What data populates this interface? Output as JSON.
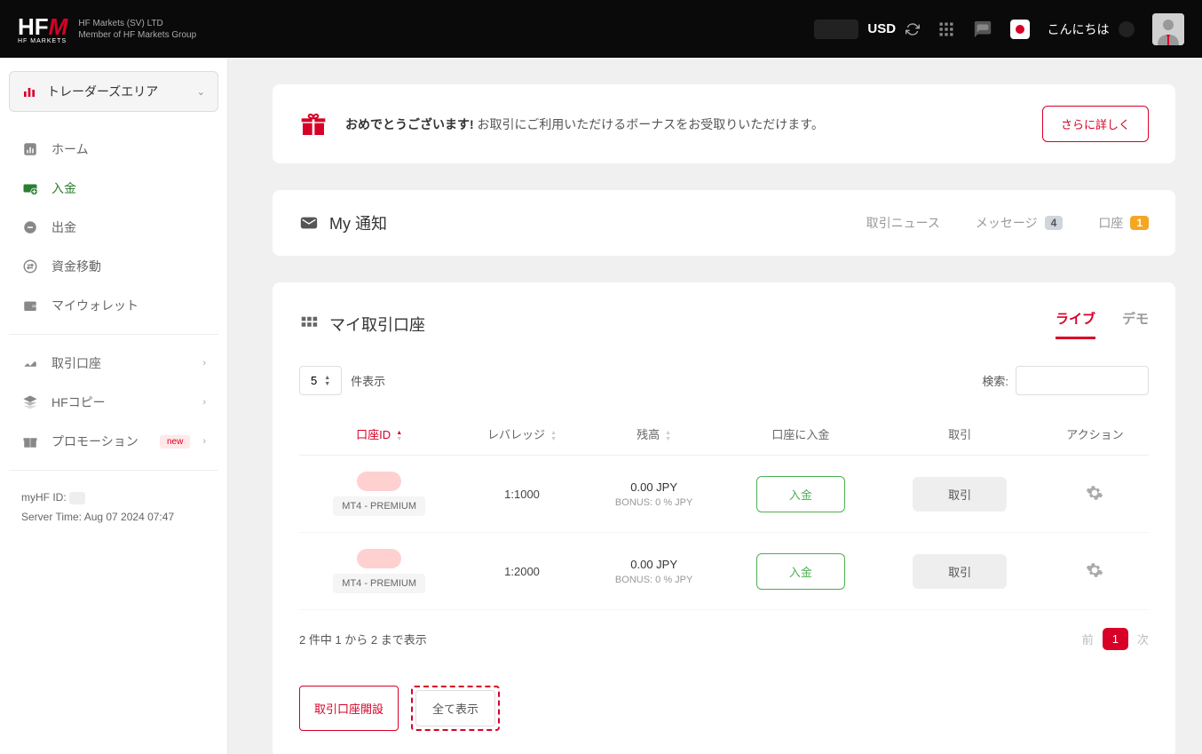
{
  "header": {
    "company_line1": "HF Markets (SV) LTD",
    "company_line2": "Member of HF Markets Group",
    "currency": "USD",
    "greeting": "こんにちは"
  },
  "sidebar": {
    "dropdown": "トレーダーズエリア",
    "items": [
      {
        "label": "ホーム",
        "icon": "chart"
      },
      {
        "label": "入金",
        "icon": "deposit",
        "green": true
      },
      {
        "label": "出金",
        "icon": "withdraw"
      },
      {
        "label": "資金移動",
        "icon": "transfer"
      },
      {
        "label": "マイウォレット",
        "icon": "wallet"
      }
    ],
    "items2": [
      {
        "label": "取引口座",
        "chev": true
      },
      {
        "label": "HFコピー",
        "chev": true
      },
      {
        "label": "プロモーション",
        "badge": "new",
        "chev": true
      }
    ],
    "info": {
      "id_label": "myHF ID:",
      "server_time": "Server Time: Aug 07 2024 07:47"
    }
  },
  "banner": {
    "bold": "おめでとうございます!",
    "text": " お取引にご利用いただけるボーナスをお受取りいただけます。",
    "button": "さらに詳しく"
  },
  "notifications": {
    "title": "My 通知",
    "tabs": [
      {
        "label": "取引ニュース"
      },
      {
        "label": "メッセージ",
        "badge": "4",
        "badge_class": "badge-gray"
      },
      {
        "label": "口座",
        "badge": "1",
        "badge_class": "badge-orange"
      }
    ]
  },
  "accounts": {
    "title": "マイ取引口座",
    "tabs": [
      {
        "label": "ライブ",
        "active": true
      },
      {
        "label": "デモ"
      }
    ],
    "page_size": "5",
    "page_size_label": "件表示",
    "search_label": "検索:",
    "columns": [
      "口座ID",
      "レバレッジ",
      "残高",
      "口座に入金",
      "取引",
      "アクション"
    ],
    "rows": [
      {
        "type": "MT4 - PREMIUM",
        "leverage": "1:1000",
        "balance": "0.00 JPY",
        "bonus": "BONUS: 0 % JPY",
        "deposit": "入金",
        "trade": "取引"
      },
      {
        "type": "MT4 - PREMIUM",
        "leverage": "1:2000",
        "balance": "0.00 JPY",
        "bonus": "BONUS: 0 % JPY",
        "deposit": "入金",
        "trade": "取引"
      }
    ],
    "footer_info": "2 件中 1 から 2 まで表示",
    "prev": "前",
    "page": "1",
    "next": "次",
    "open_account": "取引口座開設",
    "show_all": "全て表示"
  }
}
